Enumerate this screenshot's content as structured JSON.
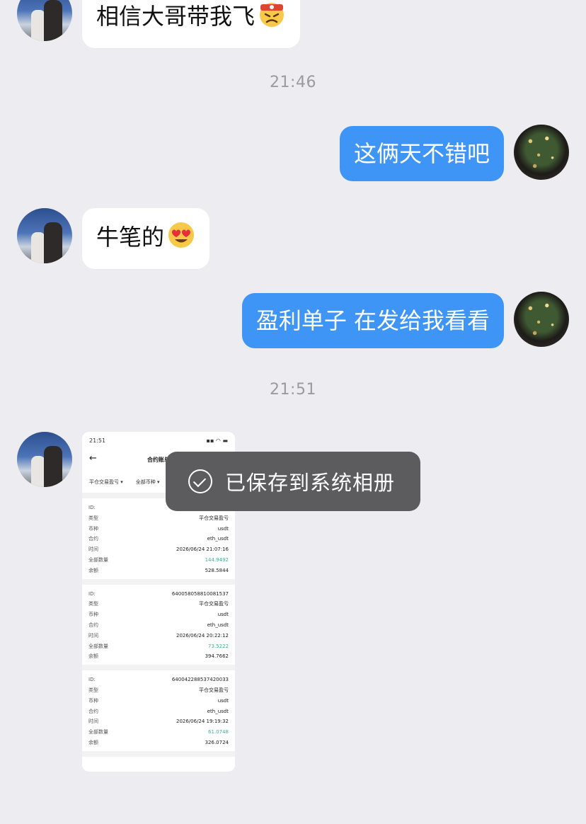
{
  "messages": [
    {
      "side": "left",
      "text": "相信大哥带我飞",
      "emoji": "angry-headband-emoji"
    },
    {
      "side": "time",
      "text": "21:46"
    },
    {
      "side": "right",
      "text": "这俩天不错吧"
    },
    {
      "side": "left",
      "text": "牛笔的",
      "emoji": "heart-eyes-emoji"
    },
    {
      "side": "right",
      "text": "盈利单子 在发给我看看"
    },
    {
      "side": "time",
      "text": "21:51"
    }
  ],
  "screenshot": {
    "status_time": "21:51",
    "title": "合约账单",
    "filter1": "平仓交易盈亏",
    "filter2": "全部币种",
    "records": [
      {
        "id_label": "ID:",
        "id": "",
        "type_label": "类型",
        "type": "平仓交易盈亏",
        "coin_label": "币种",
        "coin": "usdt",
        "contract_label": "合约",
        "contract": "eth_usdt",
        "time_label": "时间",
        "time": "2026/06/24 21:07:16",
        "amount_label": "全部数量",
        "amount": "144.9492",
        "balance_label": "余额",
        "balance": "528.5844"
      },
      {
        "id_label": "ID:",
        "id": "640058058810081537",
        "type_label": "类型",
        "type": "平仓交易盈亏",
        "coin_label": "币种",
        "coin": "usdt",
        "contract_label": "合约",
        "contract": "eth_usdt",
        "time_label": "时间",
        "time": "2026/06/24 20:22:12",
        "amount_label": "全部数量",
        "amount": "73.5222",
        "balance_label": "余额",
        "balance": "394.7662"
      },
      {
        "id_label": "ID:",
        "id": "640042288537420033",
        "type_label": "类型",
        "type": "平仓交易盈亏",
        "coin_label": "币种",
        "coin": "usdt",
        "contract_label": "合约",
        "contract": "eth_usdt",
        "time_label": "时间",
        "time": "2026/06/24 19:19:32",
        "amount_label": "全部数量",
        "amount": "61.0748",
        "balance_label": "余额",
        "balance": "326.0724"
      }
    ]
  },
  "toast": {
    "text": "已保存到系统相册",
    "icon": "check-circle-icon"
  },
  "colors": {
    "background": "#ededf1",
    "sent_bubble": "#3f95f6",
    "received_bubble": "#ffffff",
    "profit_green": "#3cb58c",
    "toast": "#5c5c5e"
  }
}
